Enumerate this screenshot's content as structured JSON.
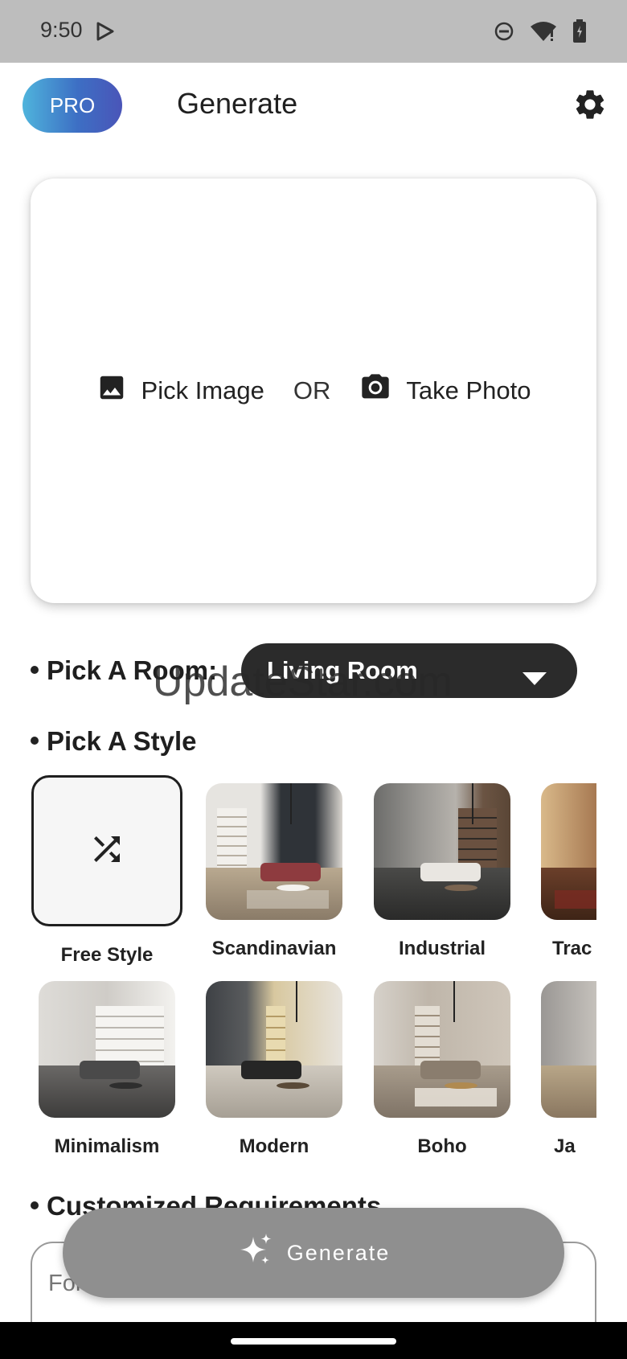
{
  "status_bar": {
    "time": "9:50"
  },
  "header": {
    "pro_label": "PRO",
    "title": "Generate"
  },
  "picker": {
    "pick_image": "Pick Image",
    "or": "OR",
    "take_photo": "Take Photo"
  },
  "room": {
    "label": "Pick A Room:",
    "selected": "Living Room"
  },
  "style": {
    "label": "Pick A Style",
    "items": [
      {
        "label": "Free Style"
      },
      {
        "label": "Scandinavian"
      },
      {
        "label": "Industrial"
      },
      {
        "label": "Trac"
      },
      {
        "label": "Minimalism"
      },
      {
        "label": "Modern"
      },
      {
        "label": "Boho"
      },
      {
        "label": "Ja"
      }
    ]
  },
  "custom": {
    "label": "Customized Requirements",
    "placeholder": "For"
  },
  "generate_button": {
    "label": "Generate"
  },
  "watermark": "UpdateStar.com",
  "colors": {
    "pro_gradient_start": "#4fb4dc",
    "pro_gradient_end": "#4a55b8",
    "dropdown_bg": "#2b2b2b",
    "generate_bg": "#8f8f8f"
  }
}
